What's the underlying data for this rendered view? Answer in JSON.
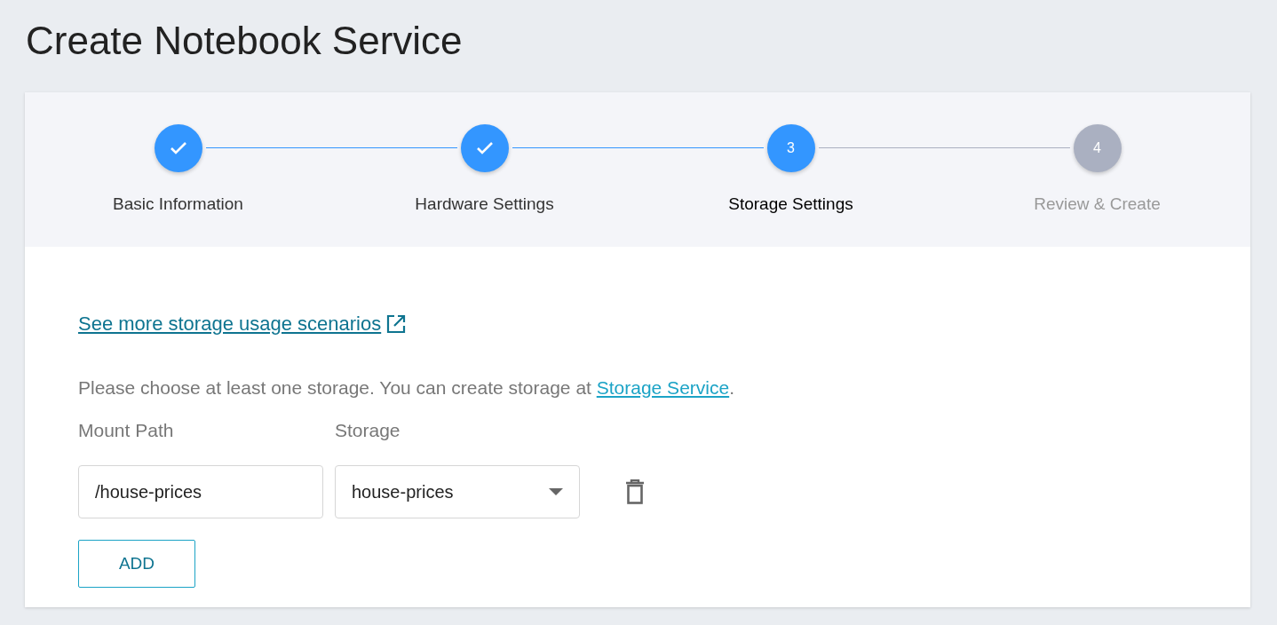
{
  "page_title": "Create Notebook Service",
  "steps": [
    {
      "label": "Basic Information",
      "completed": true,
      "selected": false
    },
    {
      "label": "Hardware Settings",
      "completed": true,
      "selected": false
    },
    {
      "label": "Storage Settings",
      "completed": false,
      "selected": true,
      "number": "3"
    },
    {
      "label": "Review & Create",
      "completed": false,
      "selected": false,
      "number": "4"
    }
  ],
  "scenarios_link": "See more storage usage scenarios",
  "notice": {
    "text": "Please choose at least one storage. You can create storage at ",
    "link": "Storage Service",
    "after": "."
  },
  "columns": [
    "Mount Path",
    "Storage"
  ],
  "mounts": [
    {
      "mount_path": "/house-prices",
      "storage": "house-prices"
    }
  ],
  "add_button": "ADD"
}
